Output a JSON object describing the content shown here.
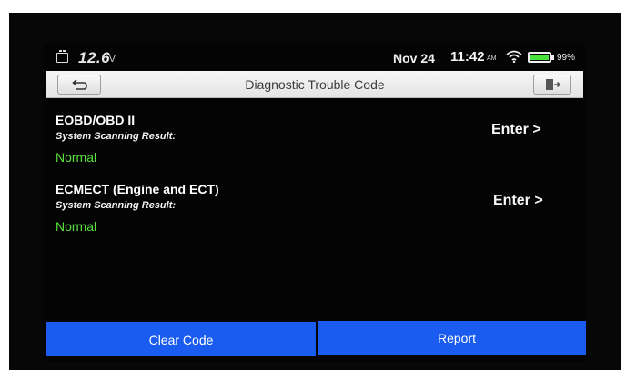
{
  "status_bar": {
    "voltage": "12.6",
    "voltage_unit": "V",
    "date": "Nov 24",
    "time": "11:42",
    "ampm": "AM",
    "battery_percent": "99%",
    "battery_level": 0.99,
    "icons": [
      "battery-car-icon",
      "wifi-icon",
      "battery-icon"
    ]
  },
  "header": {
    "title": "Diagnostic Trouble Code",
    "back_icon": "back-arrow-icon",
    "exit_icon": "exit-door-icon"
  },
  "systems": [
    {
      "name": "EOBD/OBD II",
      "scan_label": "System Scanning Result:",
      "result": "Normal",
      "enter_label": "Enter >"
    },
    {
      "name": "ECMECT (Engine and ECT)",
      "scan_label": "System Scanning Result:",
      "result": "Normal",
      "enter_label": "Enter >"
    }
  ],
  "footer": {
    "clear_code_label": "Clear Code",
    "report_label": "Report"
  },
  "colors": {
    "button_blue": "#1a5cf0",
    "result_green": "#59e23c",
    "screen_background": "#040404"
  }
}
